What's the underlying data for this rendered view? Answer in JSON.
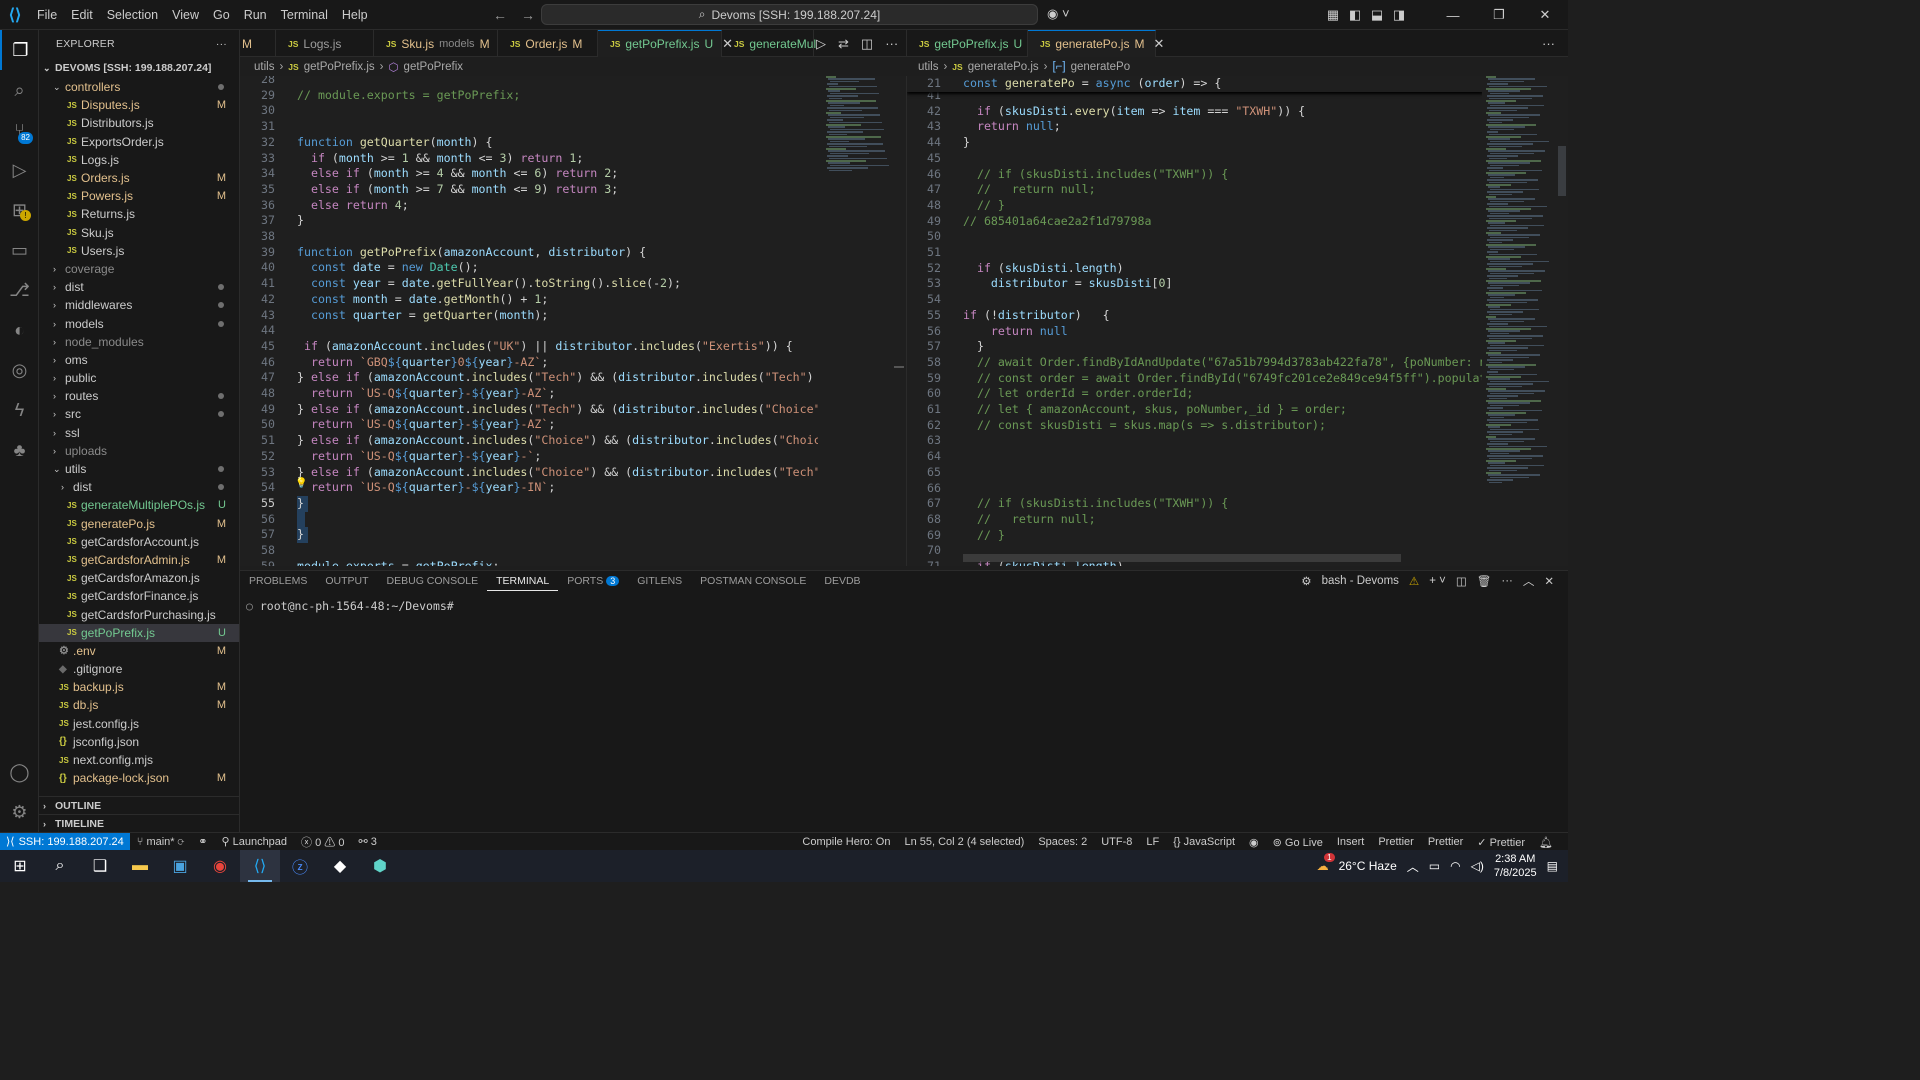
{
  "window": {
    "menu": [
      "File",
      "Edit",
      "Selection",
      "View",
      "Go",
      "Run",
      "Terminal",
      "Help"
    ],
    "search": "Devoms [SSH: 199.188.207.24]"
  },
  "sidebar": {
    "title": "EXPLORER",
    "root": "DEVOMS [SSH: 199.188.207.24]",
    "items": [
      {
        "name": "controllers",
        "type": "folder-open",
        "indent": 1,
        "status": "dot",
        "color": "mod"
      },
      {
        "name": "Disputes.js",
        "type": "js",
        "indent": 2,
        "status": "M",
        "color": "mod"
      },
      {
        "name": "Distributors.js",
        "type": "js",
        "indent": 2,
        "status": "",
        "color": ""
      },
      {
        "name": "ExportsOrder.js",
        "type": "js",
        "indent": 2,
        "status": "",
        "color": ""
      },
      {
        "name": "Logs.js",
        "type": "js",
        "indent": 2,
        "status": "",
        "color": ""
      },
      {
        "name": "Orders.js",
        "type": "js",
        "indent": 2,
        "status": "M",
        "color": "mod"
      },
      {
        "name": "Powers.js",
        "type": "js",
        "indent": 2,
        "status": "M",
        "color": "mod"
      },
      {
        "name": "Returns.js",
        "type": "js",
        "indent": 2,
        "status": "",
        "color": ""
      },
      {
        "name": "Sku.js",
        "type": "js",
        "indent": 2,
        "status": "",
        "color": ""
      },
      {
        "name": "Users.js",
        "type": "js",
        "indent": 2,
        "status": "",
        "color": ""
      },
      {
        "name": "coverage",
        "type": "folder",
        "indent": 1,
        "status": "",
        "color": "dim"
      },
      {
        "name": "dist",
        "type": "folder",
        "indent": 1,
        "status": "dot",
        "color": ""
      },
      {
        "name": "middlewares",
        "type": "folder",
        "indent": 1,
        "status": "dot",
        "color": ""
      },
      {
        "name": "models",
        "type": "folder",
        "indent": 1,
        "status": "dot",
        "color": ""
      },
      {
        "name": "node_modules",
        "type": "folder",
        "indent": 1,
        "status": "",
        "color": "dim"
      },
      {
        "name": "oms",
        "type": "folder",
        "indent": 1,
        "status": "",
        "color": ""
      },
      {
        "name": "public",
        "type": "folder",
        "indent": 1,
        "status": "",
        "color": ""
      },
      {
        "name": "routes",
        "type": "folder",
        "indent": 1,
        "status": "dot",
        "color": ""
      },
      {
        "name": "src",
        "type": "folder",
        "indent": 1,
        "status": "dot",
        "color": ""
      },
      {
        "name": "ssl",
        "type": "folder",
        "indent": 1,
        "status": "",
        "color": ""
      },
      {
        "name": "uploads",
        "type": "folder",
        "indent": 1,
        "status": "",
        "color": "dim"
      },
      {
        "name": "utils",
        "type": "folder-open",
        "indent": 1,
        "status": "dot",
        "color": ""
      },
      {
        "name": "dist",
        "type": "folder",
        "indent": 2,
        "status": "dot",
        "color": ""
      },
      {
        "name": "generateMultiplePOs.js",
        "type": "js",
        "indent": 2,
        "status": "U",
        "color": "unt"
      },
      {
        "name": "generatePo.js",
        "type": "js",
        "indent": 2,
        "status": "M",
        "color": "mod"
      },
      {
        "name": "getCardsforAccount.js",
        "type": "js",
        "indent": 2,
        "status": "",
        "color": ""
      },
      {
        "name": "getCardsforAdmin.js",
        "type": "js",
        "indent": 2,
        "status": "M",
        "color": "mod"
      },
      {
        "name": "getCardsforAmazon.js",
        "type": "js",
        "indent": 2,
        "status": "",
        "color": ""
      },
      {
        "name": "getCardsforFinance.js",
        "type": "js",
        "indent": 2,
        "status": "",
        "color": ""
      },
      {
        "name": "getCardsforPurchasing.js",
        "type": "js",
        "indent": 2,
        "status": "",
        "color": ""
      },
      {
        "name": "getPoPrefix.js",
        "type": "js",
        "indent": 2,
        "status": "U",
        "color": "unt",
        "selected": true
      },
      {
        "name": ".env",
        "type": "gear",
        "indent": 1,
        "status": "M",
        "color": "mod"
      },
      {
        "name": ".gitignore",
        "type": "git",
        "indent": 1,
        "status": "",
        "color": ""
      },
      {
        "name": "backup.js",
        "type": "js",
        "indent": 1,
        "status": "M",
        "color": "mod"
      },
      {
        "name": "db.js",
        "type": "js",
        "indent": 1,
        "status": "M",
        "color": "mod"
      },
      {
        "name": "jest.config.js",
        "type": "js",
        "indent": 1,
        "status": "",
        "color": ""
      },
      {
        "name": "jsconfig.json",
        "type": "json",
        "indent": 1,
        "status": "",
        "color": ""
      },
      {
        "name": "next.config.mjs",
        "type": "js",
        "indent": 1,
        "status": "",
        "color": ""
      },
      {
        "name": "package-lock.json",
        "type": "json",
        "indent": 1,
        "status": "M",
        "color": "mod"
      }
    ],
    "outline": "OUTLINE",
    "timeline": "TIMELINE"
  },
  "tabs": [
    {
      "label": "Logs.js",
      "desc": "",
      "status": ""
    },
    {
      "label": "Sku.js",
      "desc": "models",
      "status": "M"
    },
    {
      "label": "Order.js",
      "desc": "",
      "status": "M"
    },
    {
      "label": "getPoPrefix.js",
      "desc": "",
      "status": "U"
    },
    {
      "label": "generateMul",
      "desc": "",
      "status": ""
    },
    {
      "label": "getPoPrefix.js",
      "desc": "",
      "status": "U"
    },
    {
      "label": "generatePo.js",
      "desc": "",
      "status": "M"
    }
  ],
  "tab_partial": "M",
  "left_editor": {
    "breadcrumb": [
      "utils",
      "getPoPrefix.js",
      "getPoPrefix"
    ],
    "current_line": 55,
    "lines": [
      {
        "n": 28,
        "t": ""
      },
      {
        "n": 29,
        "t": "// module.exports = getPoPrefix;"
      },
      {
        "n": 30,
        "t": ""
      },
      {
        "n": 31,
        "t": ""
      },
      {
        "n": 32,
        "t": "function getQuarter(month) {"
      },
      {
        "n": 33,
        "t": "  if (month >= 1 && month <= 3) return 1;"
      },
      {
        "n": 34,
        "t": "  else if (month >= 4 && month <= 6) return 2;"
      },
      {
        "n": 35,
        "t": "  else if (month >= 7 && month <= 9) return 3;"
      },
      {
        "n": 36,
        "t": "  else return 4;"
      },
      {
        "n": 37,
        "t": "}"
      },
      {
        "n": 38,
        "t": ""
      },
      {
        "n": 39,
        "t": "function getPoPrefix(amazonAccount, distributor) {"
      },
      {
        "n": 40,
        "t": "  const date = new Date();"
      },
      {
        "n": 41,
        "t": "  const year = date.getFullYear().toString().slice(-2);"
      },
      {
        "n": 42,
        "t": "  const month = date.getMonth() + 1;"
      },
      {
        "n": 43,
        "t": "  const quarter = getQuarter(month);"
      },
      {
        "n": 44,
        "t": ""
      },
      {
        "n": 45,
        "t": " if (amazonAccount.includes(\"UK\") || distributor.includes(\"Exertis\")) {"
      },
      {
        "n": 46,
        "t": "  return `GBQ${quarter}0${year}-AZ`;"
      },
      {
        "n": 47,
        "t": "} else if (amazonAccount.includes(\"Tech\") && (distributor.includes(\"Tech\") || dist"
      },
      {
        "n": 48,
        "t": "  return `US-Q${quarter}-${year}-AZ`;"
      },
      {
        "n": 49,
        "t": "} else if (amazonAccount.includes(\"Tech\") && (distributor.includes(\"Choice\") || di"
      },
      {
        "n": 50,
        "t": "  return `US-Q${quarter}-${year}-AZ`;"
      },
      {
        "n": 51,
        "t": "} else if (amazonAccount.includes(\"Choice\") && (distributor.includes(\"Choice\") || "
      },
      {
        "n": 52,
        "t": "  return `US-Q${quarter}-${year}-`;"
      },
      {
        "n": 53,
        "t": "} else if (amazonAccount.includes(\"Choice\") && (distributor.includes(\"Tech\") || di"
      },
      {
        "n": 54,
        "t": "  return `US-Q${quarter}-${year}-IN`;"
      },
      {
        "n": 55,
        "t": "}"
      },
      {
        "n": 56,
        "t": ""
      },
      {
        "n": 57,
        "t": "}"
      },
      {
        "n": 58,
        "t": ""
      },
      {
        "n": 59,
        "t": "module.exports = getPoPrefix;"
      }
    ]
  },
  "right_editor": {
    "breadcrumb": [
      "utils",
      "generatePo.js",
      "generatePo"
    ],
    "sticky": {
      "n": 21,
      "t": "const generatePo = async (order) => {"
    },
    "lines": [
      {
        "n": 41,
        "t": ""
      },
      {
        "n": 42,
        "t": "  if (skusDisti.every(item => item === \"TXWH\")) {"
      },
      {
        "n": 43,
        "t": "  return null;"
      },
      {
        "n": 44,
        "t": "}"
      },
      {
        "n": 45,
        "t": ""
      },
      {
        "n": 46,
        "t": "  // if (skusDisti.includes(\"TXWH\")) {"
      },
      {
        "n": 47,
        "t": "  //   return null;"
      },
      {
        "n": 48,
        "t": "  // }"
      },
      {
        "n": 49,
        "t": "// 685401a64cae2a2f1d79798a"
      },
      {
        "n": 50,
        "t": ""
      },
      {
        "n": 51,
        "t": ""
      },
      {
        "n": 52,
        "t": "  if (skusDisti.length)"
      },
      {
        "n": 53,
        "t": "    distributor = skusDisti[0]"
      },
      {
        "n": 54,
        "t": ""
      },
      {
        "n": 55,
        "t": "if (!distributor)   {"
      },
      {
        "n": 56,
        "t": "    return null"
      },
      {
        "n": 57,
        "t": "  }"
      },
      {
        "n": 58,
        "t": "  // await Order.findByIdAndUpdate(\"67a51b7994d3783ab422fa78\", {poNumber: null, po"
      },
      {
        "n": 59,
        "t": "  // const order = await Order.findById(\"6749fc201ce2e849ce94f5ff\").populate(\"skus"
      },
      {
        "n": 60,
        "t": "  // let orderId = order.orderId;"
      },
      {
        "n": 61,
        "t": "  // let { amazonAccount, skus, poNumber,_id } = order;"
      },
      {
        "n": 62,
        "t": "  // const skusDisti = skus.map(s => s.distributor);"
      },
      {
        "n": 63,
        "t": ""
      },
      {
        "n": 64,
        "t": ""
      },
      {
        "n": 65,
        "t": ""
      },
      {
        "n": 66,
        "t": ""
      },
      {
        "n": 67,
        "t": "  // if (skusDisti.includes(\"TXWH\")) {"
      },
      {
        "n": 68,
        "t": "  //   return null;"
      },
      {
        "n": 69,
        "t": "  // }"
      },
      {
        "n": 70,
        "t": ""
      },
      {
        "n": 71,
        "t": "  if (skusDisti.length)"
      }
    ]
  },
  "panel": {
    "tabs": [
      "PROBLEMS",
      "OUTPUT",
      "DEBUG CONSOLE",
      "TERMINAL",
      "PORTS",
      "GITLENS",
      "POSTMAN CONSOLE",
      "DEVDB"
    ],
    "active": "TERMINAL",
    "ports_count": "3",
    "terminal_name": "bash - Devoms",
    "prompt": "root@nc-ph-1564-48:~/Devoms#"
  },
  "statusbar": {
    "remote": "SSH: 199.188.207.24",
    "branch": "main*",
    "launchpad": "Launchpad",
    "errors": "0",
    "warnings": "0",
    "ports": "3",
    "compile_hero": "Compile Hero: On",
    "position": "Ln 55, Col 2 (4 selected)",
    "spaces": "Spaces: 2",
    "encoding": "UTF-8",
    "eol": "LF",
    "language": "JavaScript",
    "golive": "Go Live",
    "insert": "Insert",
    "prettier1": "Prettier",
    "prettier2": "Prettier",
    "prettier3": "Prettier"
  },
  "taskbar": {
    "weather": "26°C Haze",
    "time": "2:38 AM",
    "date": "7/8/2025",
    "weather_badge": "1"
  },
  "colors": {
    "accent": "#0078d4",
    "modified": "#e2c08d",
    "untracked": "#73c991",
    "js_icon": "#cbcb41"
  }
}
